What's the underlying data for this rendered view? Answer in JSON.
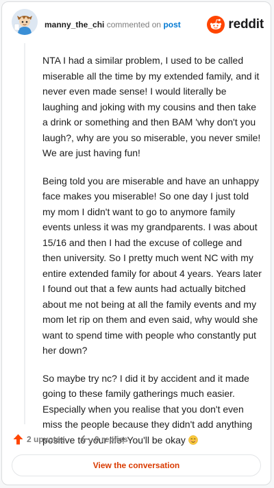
{
  "comment": {
    "author": "manny_the_chi",
    "commented_text": "commented on",
    "post_link": "post",
    "paragraphs": [
      "NTA I had a similar problem, I used to be called miserable all the time by my extended family, and it never even made sense! I would literally be laughing and joking with my cousins and then take a drink or something and then BAM 'why don't you laugh?, why are you so miserable, you never smile! We are just having fun!",
      "Being told you are miserable and have an unhappy face makes you miserable! So one day I just told my mom I didn't want to go to anymore family events unless it was my grandparents. I was about 15/16 and then I had the excuse of college and then university. So I pretty much went NC with my entire extended family for about 4 years. Years later I found out that a few aunts had actually bitched about me not being at all the family events and my mom let rip on them and even said, why would she want to spend time with people who constantly put her down?",
      "So maybe try nc? I did it by accident and it made going to these family gatherings much easier. Especially when you realise that you don't even miss the people because they didn't add anything positive to your life! You'll be okay"
    ],
    "emoji_icon": "blushing-smile-emoji",
    "upvotes": "2 upvotes",
    "replies": "0 replies",
    "view_button": "View the conversation"
  },
  "brand": {
    "name": "reddit",
    "icon": "reddit-snoo-icon",
    "color": "#ff4500"
  },
  "colors": {
    "accent": "#d93a00",
    "upvote": "#ff4500",
    "link": "#0079d3"
  }
}
